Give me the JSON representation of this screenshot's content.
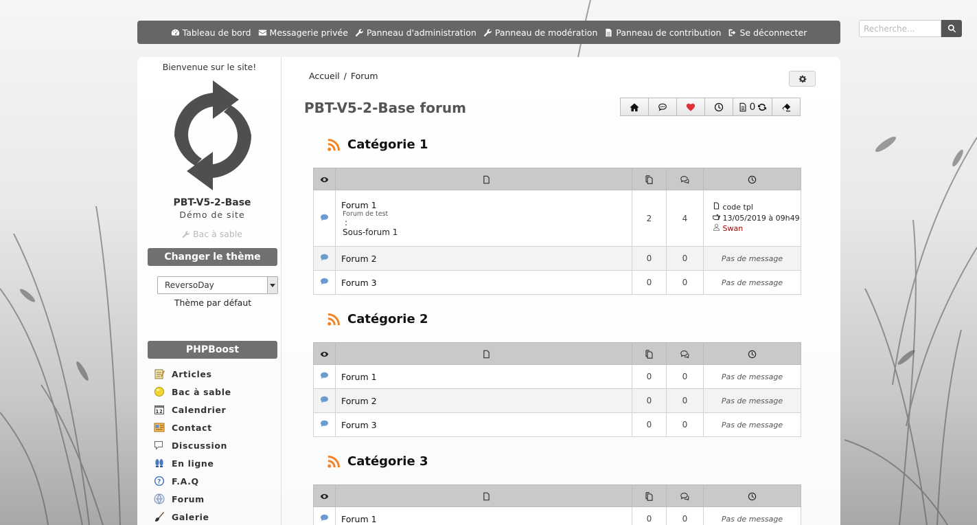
{
  "topbar": {
    "items": [
      {
        "label": "Tableau de bord",
        "icon": "dashboard-icon"
      },
      {
        "label": "Messagerie privée",
        "icon": "envelope-icon"
      },
      {
        "label": "Panneau d'administration",
        "icon": "wrench-icon"
      },
      {
        "label": "Panneau de modération",
        "icon": "gavel-icon"
      },
      {
        "label": "Panneau de contribution",
        "icon": "file-icon"
      },
      {
        "label": "Se déconnecter",
        "icon": "sign-out-icon"
      }
    ]
  },
  "search": {
    "placeholder": "Recherche..."
  },
  "sidebar": {
    "welcome": "Bienvenue sur le site!",
    "site_name": "PBT-V5-2-Base",
    "site_desc": "Démo de site",
    "sandbox": "Bac à sable",
    "theme_heading": "Changer le thème",
    "theme_selected": "ReversoDay",
    "theme_default": "Thème par défaut",
    "menu_heading": "PHPBoost",
    "menu": [
      {
        "label": "Articles",
        "icon": "articles-icon"
      },
      {
        "label": "Bac à sable",
        "icon": "sandbox-icon"
      },
      {
        "label": "Calendrier",
        "icon": "calendar-icon"
      },
      {
        "label": "Contact",
        "icon": "contact-icon"
      },
      {
        "label": "Discussion",
        "icon": "discussion-icon"
      },
      {
        "label": "En ligne",
        "icon": "online-icon"
      },
      {
        "label": "F.A.Q",
        "icon": "faq-icon"
      },
      {
        "label": "Forum",
        "icon": "forum-icon"
      },
      {
        "label": "Galerie",
        "icon": "gallery-icon"
      }
    ]
  },
  "main": {
    "breadcrumb": {
      "home": "Accueil",
      "sep": "/",
      "current": "Forum"
    },
    "title": "PBT-V5-2-Base forum",
    "unread_count": "0",
    "categories": [
      {
        "title": "Catégorie 1",
        "rows": [
          {
            "name": "Forum 1",
            "desc": "Forum de test",
            "colon": ":",
            "sub": "Sous-forum 1",
            "topics": "2",
            "messages": "4",
            "last": {
              "topic": "code tpl",
              "date": "13/05/2019 à 09h49",
              "user": "Swan"
            }
          },
          {
            "name": "Forum 2",
            "topics": "0",
            "messages": "0",
            "nomsg": "Pas de message"
          },
          {
            "name": "Forum 3",
            "topics": "0",
            "messages": "0",
            "nomsg": "Pas de message"
          }
        ]
      },
      {
        "title": "Catégorie 2",
        "rows": [
          {
            "name": "Forum 1",
            "topics": "0",
            "messages": "0",
            "nomsg": "Pas de message"
          },
          {
            "name": "Forum 2",
            "topics": "0",
            "messages": "0",
            "nomsg": "Pas de message"
          },
          {
            "name": "Forum 3",
            "topics": "0",
            "messages": "0",
            "nomsg": "Pas de message"
          }
        ]
      },
      {
        "title": "Catégorie 3",
        "rows": [
          {
            "name": "Forum 1",
            "topics": "0",
            "messages": "0",
            "nomsg": "Pas de message"
          }
        ]
      }
    ]
  },
  "colors": {
    "topbar": "#666666",
    "menu_head": "#707070",
    "rss": "#f58220",
    "heart": "#e0303a",
    "user": "#aa0000",
    "bubble": "#6a9bd1"
  }
}
